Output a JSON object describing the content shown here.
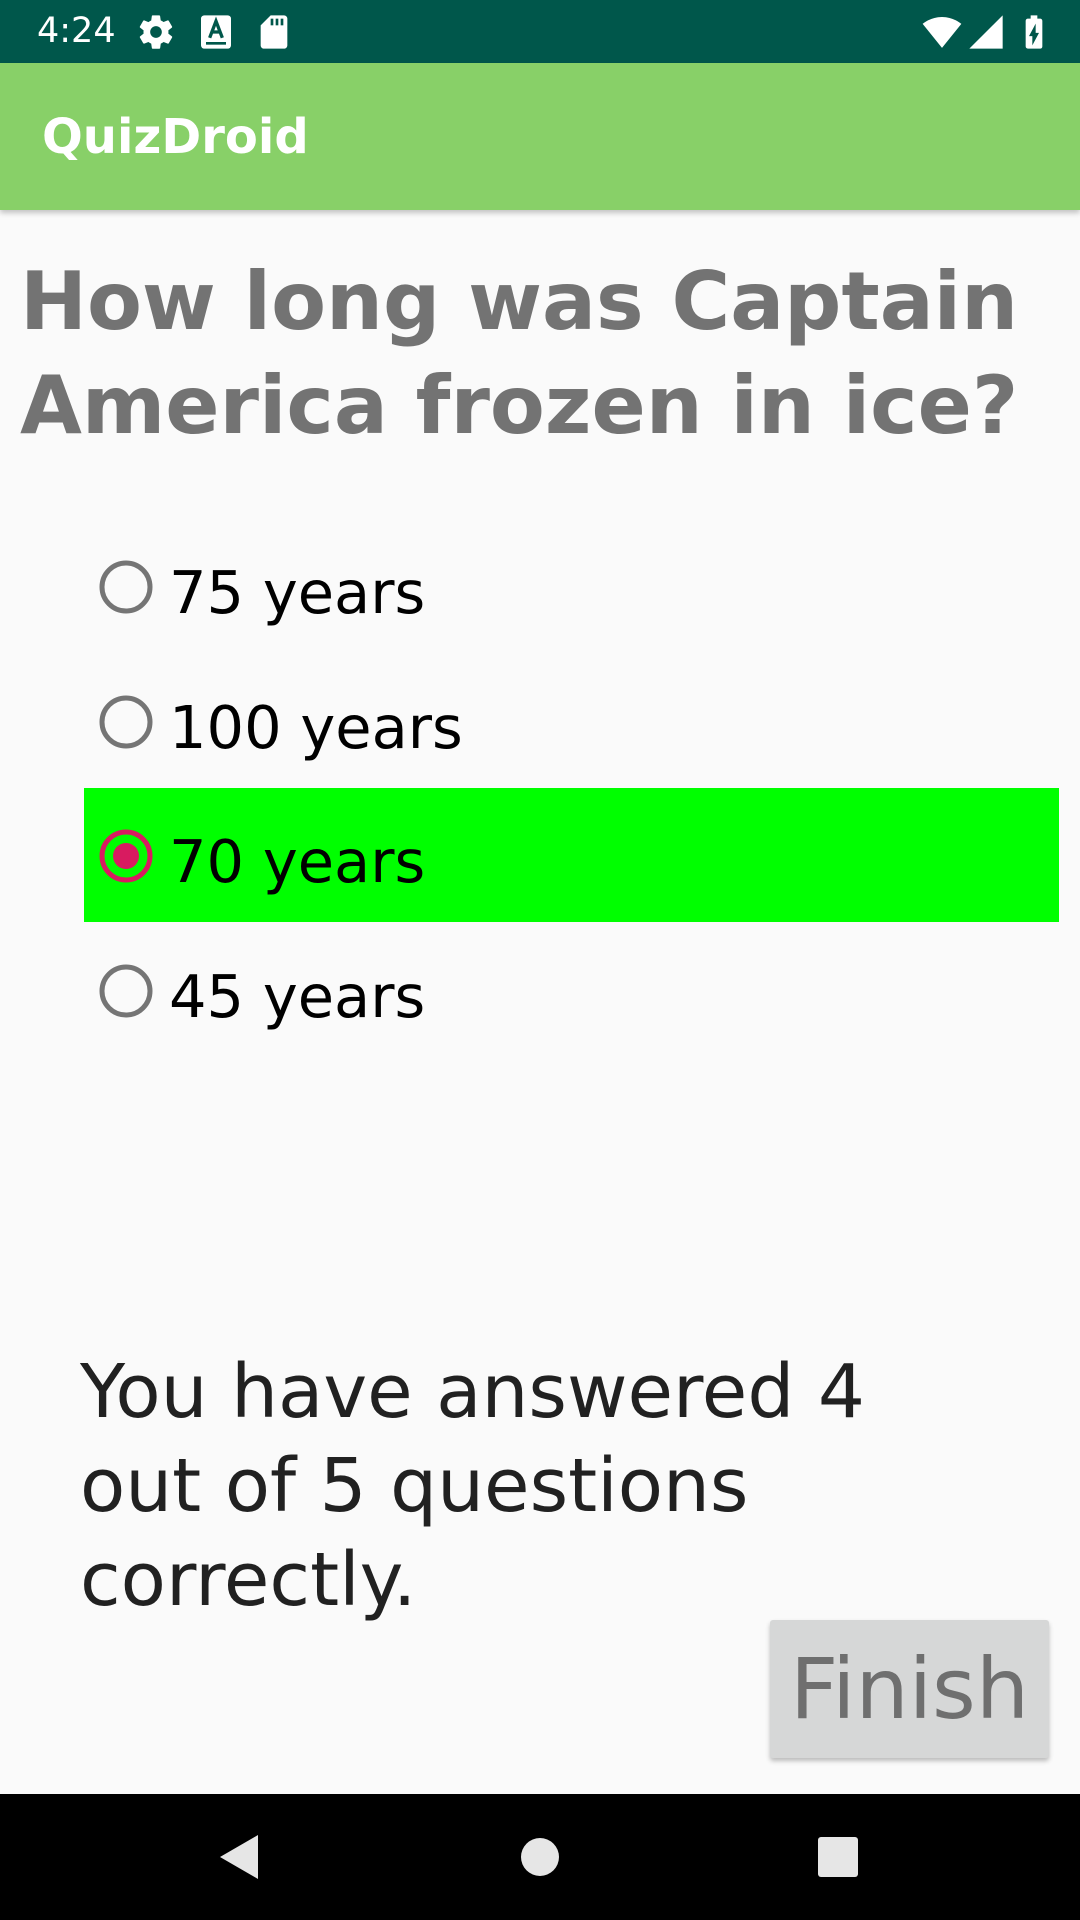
{
  "status_bar": {
    "time": "4:24",
    "icons": [
      "gear-icon",
      "keyboard-a-icon",
      "sd-card-icon",
      "wifi-icon",
      "signal-icon",
      "battery-charging-icon"
    ]
  },
  "app_bar": {
    "title": "QuizDroid",
    "color": "#88d068"
  },
  "question": {
    "text": "How long was Captain America frozen in ice?",
    "options": [
      {
        "label": "75 years",
        "selected": false
      },
      {
        "label": "100 years",
        "selected": false
      },
      {
        "label": "70 years",
        "selected": true
      },
      {
        "label": "45 years",
        "selected": false
      }
    ]
  },
  "score": {
    "text": "You have answered 4 out of 5 questions correctly."
  },
  "finish_button": {
    "label": "Finish"
  },
  "nav_bar": {
    "icons": [
      "back-icon",
      "home-icon",
      "recents-icon"
    ]
  },
  "colors": {
    "status_bar": "#00574b",
    "correct_highlight": "#00ff00",
    "radio_accent": "#d81b60"
  }
}
